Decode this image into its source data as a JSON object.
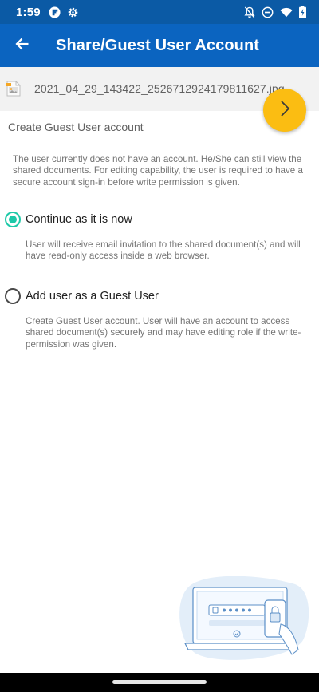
{
  "status_bar": {
    "time": "1:59",
    "icons": [
      "flipboard-icon",
      "settings-gear-icon",
      "notifications-off-icon",
      "do-not-disturb-icon",
      "wifi-icon",
      "battery-icon"
    ]
  },
  "app_bar": {
    "title": "Share/Guest User Account",
    "back_icon": "arrow-back-icon"
  },
  "file": {
    "name": "2021_04_29_143422_2526712924179811627.jpg",
    "icon": "image-file-icon"
  },
  "next_button": {
    "icon": "chevron-right-icon"
  },
  "section_title": "Create Guest User account",
  "intro_text": "The user currently does not have an account. He/She can still view the shared documents. For editing capability, the user is required to have a secure account sign-in before write permission is given.",
  "options": [
    {
      "label": "Continue as it is now",
      "checked": true,
      "description": "User will receive email invitation to the shared document(s) and will have read-only access inside a web browser."
    },
    {
      "label": "Add user as a Guest User",
      "checked": false,
      "description": "Create Guest User account. User will have an account to access shared document(s) securely and may have editing role if the write-permission was given."
    }
  ],
  "colors": {
    "status_bar": "#0b5aa5",
    "app_bar": "#0b64c0",
    "accent_fab": "#fbbd12",
    "radio_checked": "#1ec9a8"
  }
}
